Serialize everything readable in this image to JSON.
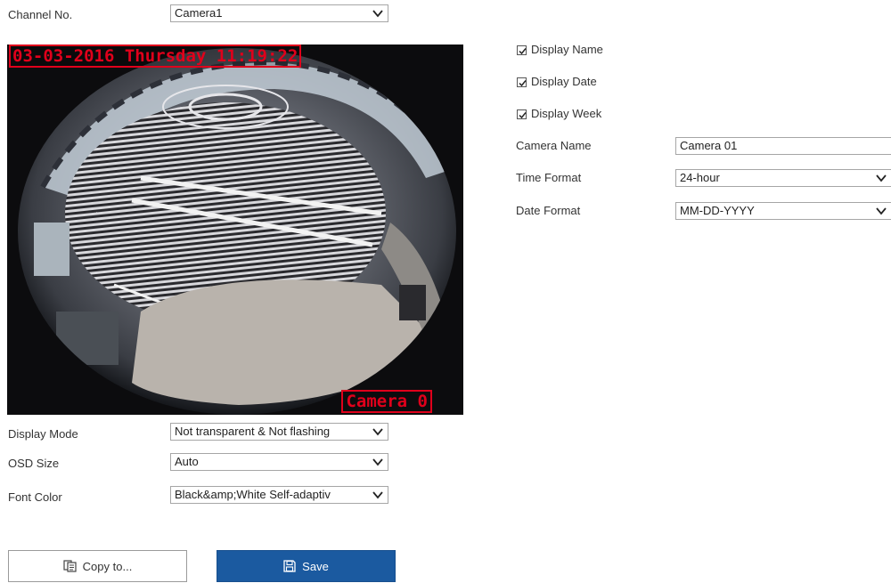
{
  "channel": {
    "label": "Channel No.",
    "value": "Camera1"
  },
  "preview": {
    "osd_date_text": "03-03-2016 Thursday 11:19:22",
    "osd_camera_text": "Camera 0"
  },
  "options": {
    "display_name": {
      "label": "Display Name",
      "checked": true
    },
    "display_date": {
      "label": "Display Date",
      "checked": true
    },
    "display_week": {
      "label": "Display Week",
      "checked": true
    }
  },
  "camera_name": {
    "label": "Camera Name",
    "value": "Camera 01"
  },
  "time_format": {
    "label": "Time Format",
    "value": "24-hour"
  },
  "date_format": {
    "label": "Date Format",
    "value": "MM-DD-YYYY"
  },
  "display_mode": {
    "label": "Display Mode",
    "value": "Not transparent & Not flashing"
  },
  "osd_size": {
    "label": "OSD Size",
    "value": "Auto"
  },
  "font_color": {
    "label": "Font Color",
    "value": "Black&amp;White Self-adaptiv"
  },
  "buttons": {
    "copy_label": "Copy to...",
    "save_label": "Save"
  },
  "colors": {
    "osd_red": "#e0001b",
    "primary_blue": "#1b5aa0",
    "border_gray": "#a6a6a6"
  },
  "icons": {
    "copy": "copy-icon",
    "save": "floppy-disk-icon",
    "dropdown": "chevron-down-icon",
    "checkbox": "checkmark-icon"
  }
}
